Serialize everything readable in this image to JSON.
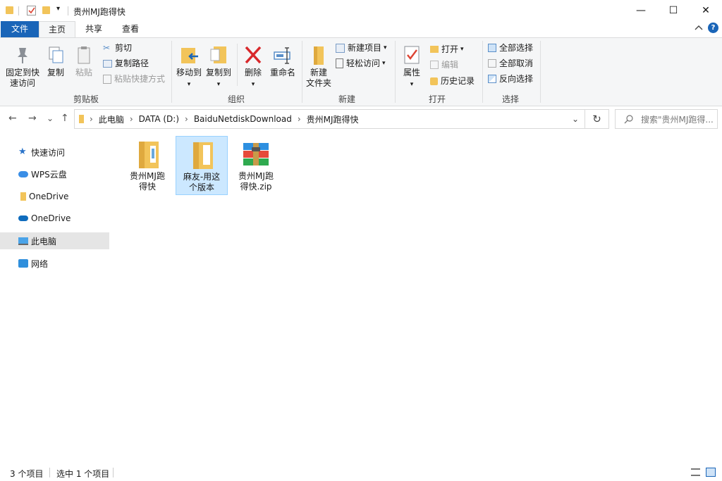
{
  "window": {
    "title": "贵州MJ跑得快",
    "qat_dropdown": "▾",
    "minimize": "—",
    "maximize": "☐",
    "close": "✕"
  },
  "tabs": {
    "file": "文件",
    "home": "主页",
    "share": "共享",
    "view": "查看"
  },
  "ribbon": {
    "clipboard": {
      "pin": "固定到快速访问",
      "pin_line1": "固定到快",
      "pin_line2": "速访问",
      "copy": "复制",
      "paste": "粘贴",
      "cut": "剪切",
      "copy_path": "复制路径",
      "paste_shortcut": "粘贴快捷方式",
      "label": "剪贴板"
    },
    "organize": {
      "move_to": "移动到",
      "copy_to": "复制到",
      "delete": "删除",
      "rename": "重命名",
      "label": "组织"
    },
    "new": {
      "new_folder_line1": "新建",
      "new_folder_line2": "文件夹",
      "new_item": "新建项目",
      "easy_access": "轻松访问",
      "label": "新建"
    },
    "open": {
      "properties": "属性",
      "open": "打开",
      "edit": "编辑",
      "history": "历史记录",
      "label": "打开"
    },
    "select": {
      "select_all": "全部选择",
      "select_none": "全部取消",
      "invert": "反向选择",
      "label": "选择"
    },
    "caret": "▾"
  },
  "nav": {
    "back": "←",
    "forward": "→",
    "recent": "⌄",
    "up": "↑",
    "breadcrumb": [
      "此电脑",
      "DATA (D:)",
      "BaiduNetdiskDownload",
      "贵州MJ跑得快"
    ],
    "sep": "›",
    "dropdown": "⌄",
    "refresh": "↻",
    "search_placeholder": "搜索\"贵州MJ跑得..."
  },
  "sidebar": {
    "items": [
      {
        "label": "快速访问"
      },
      {
        "label": "WPS云盘"
      },
      {
        "label": "OneDrive"
      },
      {
        "label": "OneDrive"
      },
      {
        "label": "此电脑"
      },
      {
        "label": "网络"
      }
    ]
  },
  "files": [
    {
      "line1": "贵州MJ跑",
      "line2": "得快"
    },
    {
      "line1": "麻友-用这",
      "line2": "个版本"
    },
    {
      "line1": "贵州MJ跑",
      "line2": "得快.zip"
    }
  ],
  "status": {
    "count": "3 个项目",
    "selected": "选中 1 个项目"
  },
  "colors": {
    "accent": "#1a65b8",
    "folder": "#f2c45a",
    "selection": "#cce8ff"
  }
}
